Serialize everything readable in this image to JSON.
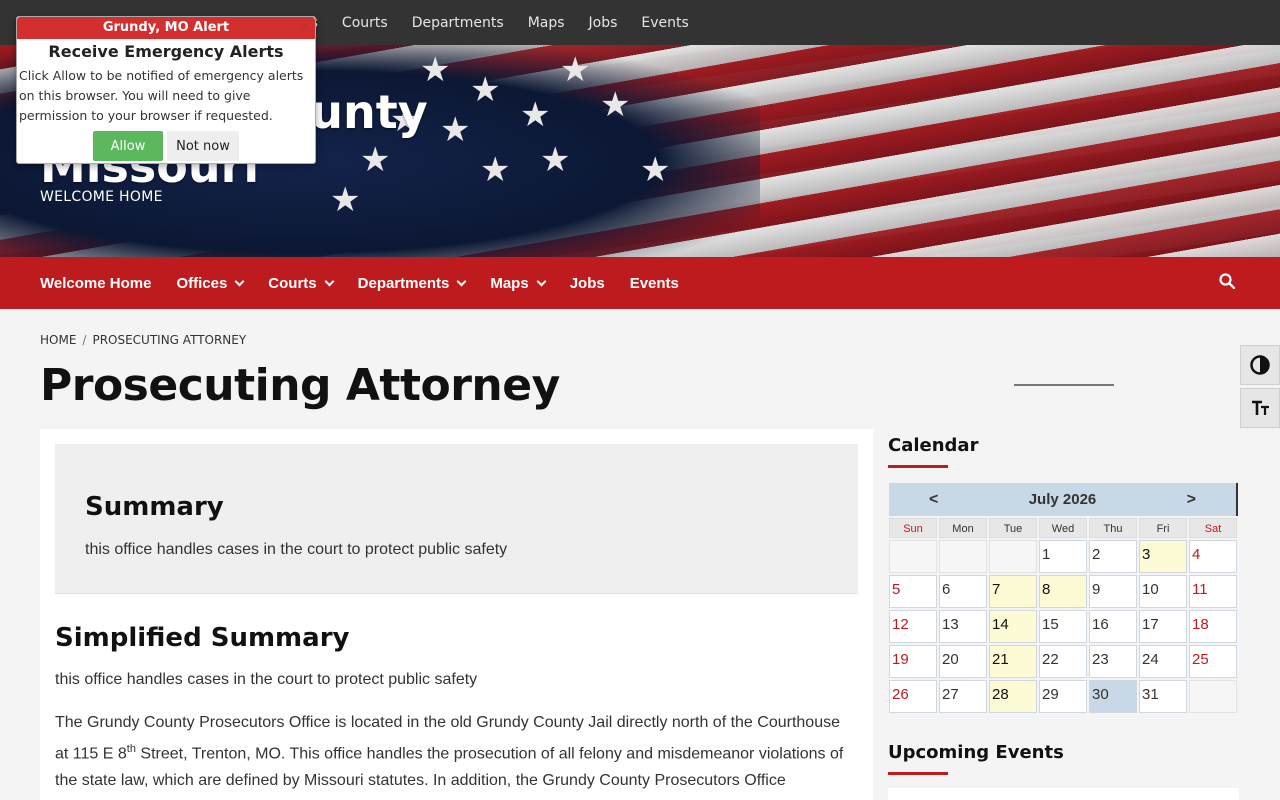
{
  "topbar": {
    "items": [
      "es",
      "Courts",
      "Departments",
      "Maps",
      "Jobs",
      "Events"
    ]
  },
  "alert": {
    "top_label": "Grundy, MO Alert",
    "close": "✕",
    "heading": "Receive Emergency Alerts",
    "message": "Click Allow to be notified of emergency alerts on this browser. You will need to give permission to your browser if requested.",
    "allow_label": "Allow",
    "not_now_label": "Not now"
  },
  "hero": {
    "title_line1": "Grundy County",
    "title_line2": "Missouri",
    "tagline": "WELCOME HOME"
  },
  "mainnav": {
    "items": [
      {
        "label": "Welcome Home",
        "dropdown": false
      },
      {
        "label": "Offices",
        "dropdown": true
      },
      {
        "label": "Courts",
        "dropdown": true
      },
      {
        "label": "Departments",
        "dropdown": true
      },
      {
        "label": "Maps",
        "dropdown": true
      },
      {
        "label": "Jobs",
        "dropdown": false
      },
      {
        "label": "Events",
        "dropdown": false
      }
    ]
  },
  "breadcrumb": {
    "home": "HOME",
    "sep": "/",
    "current": "PROSECUTING ATTORNEY"
  },
  "page_title": "Prosecuting Attorney",
  "summary": {
    "heading": "Summary",
    "text": "this office handles cases in the court to protect public safety"
  },
  "simplified": {
    "heading": "Simplified Summary",
    "text": "this office handles cases in the court to protect public safety"
  },
  "body": {
    "part1": "The Grundy County Prosecutors Office is located in the old Grundy County Jail directly north of the Courthouse at 115 E 8",
    "sup": "th",
    "part2": " Street, Trenton, MO.  This office handles the prosecution of all felony and misdemeanor violations of the state law, which are defined by Missouri statutes.  In addition, the Grundy County Prosecutors Office handles all conservation, all county violations, and state traffic violations."
  },
  "sidebar": {
    "calendar_heading": "Calendar",
    "events_heading": "Upcoming Events"
  },
  "calendar": {
    "month": "July 2026",
    "prev": "<",
    "next": ">",
    "days_of_week": [
      "Sun",
      "Mon",
      "Tue",
      "Wed",
      "Thu",
      "Fri",
      "Sat"
    ],
    "weeks": [
      [
        "",
        "",
        "",
        "1",
        "2",
        "3",
        "4"
      ],
      [
        "5",
        "6",
        "7",
        "8",
        "9",
        "10",
        "11"
      ],
      [
        "12",
        "13",
        "14",
        "15",
        "16",
        "17",
        "18"
      ],
      [
        "19",
        "20",
        "21",
        "22",
        "23",
        "24",
        "25"
      ],
      [
        "26",
        "27",
        "28",
        "29",
        "30",
        "31",
        ""
      ]
    ],
    "event_days": [
      "3",
      "7",
      "8",
      "14",
      "21",
      "28"
    ],
    "today": "30"
  },
  "colors": {
    "brand_red": "#be1b1f",
    "topbar": "#333333",
    "calendar_header": "#c9d8e6",
    "event_day": "#fdfbd5",
    "allow_green": "#5cb85c"
  },
  "icons": {
    "search": "search-icon",
    "contrast": "contrast-icon",
    "font_size": "font-size-icon"
  }
}
